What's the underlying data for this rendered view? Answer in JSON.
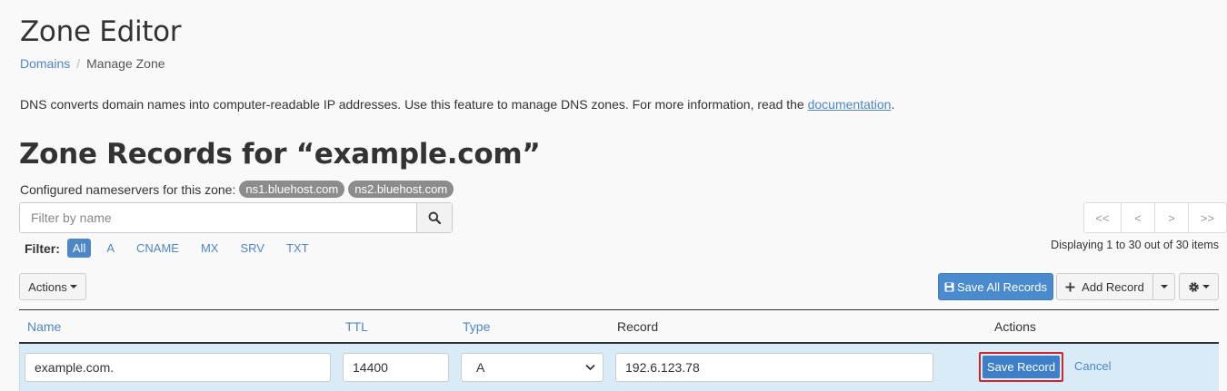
{
  "page": {
    "title": "Zone Editor",
    "breadcrumb": {
      "link": "Domains",
      "separator": "/",
      "current": "Manage Zone"
    },
    "description": {
      "text": "DNS converts domain names into computer-readable IP addresses. Use this feature to manage DNS zones. For more information, read the ",
      "link": "documentation",
      "suffix": "."
    }
  },
  "zone": {
    "title": "Zone Records for “example.com”",
    "nameservers_label": "Configured nameservers for this zone:",
    "nameservers": [
      "ns1.bluehost.com",
      "ns2.bluehost.com"
    ]
  },
  "search": {
    "placeholder": "Filter by name",
    "value": ""
  },
  "filter": {
    "label": "Filter:",
    "items": [
      "All",
      "A",
      "CNAME",
      "MX",
      "SRV",
      "TXT"
    ],
    "active": "All"
  },
  "pager": {
    "first": "<<",
    "prev": "<",
    "next": ">",
    "last": ">>",
    "info": "Displaying 1 to 30 out of 30 items"
  },
  "toolbar": {
    "actions": "Actions",
    "save_all": "Save All Records",
    "add_record": "Add Record"
  },
  "table": {
    "headers": {
      "name": "Name",
      "ttl": "TTL",
      "type": "Type",
      "record": "Record",
      "actions": "Actions"
    },
    "edit_row": {
      "name": "example.com.",
      "ttl": "14400",
      "type": "A",
      "record": "192.6.123.78",
      "save": "Save Record",
      "cancel": "Cancel"
    }
  },
  "colors": {
    "accent": "#4f86c6",
    "primary_button": "#4a8bd0",
    "highlight_border": "#d2232a",
    "row_bg": "#d9ebf6"
  },
  "icons": {
    "search": "search-icon",
    "save": "floppy-disk-icon",
    "add": "plus-icon",
    "gear": "gear-icon"
  }
}
